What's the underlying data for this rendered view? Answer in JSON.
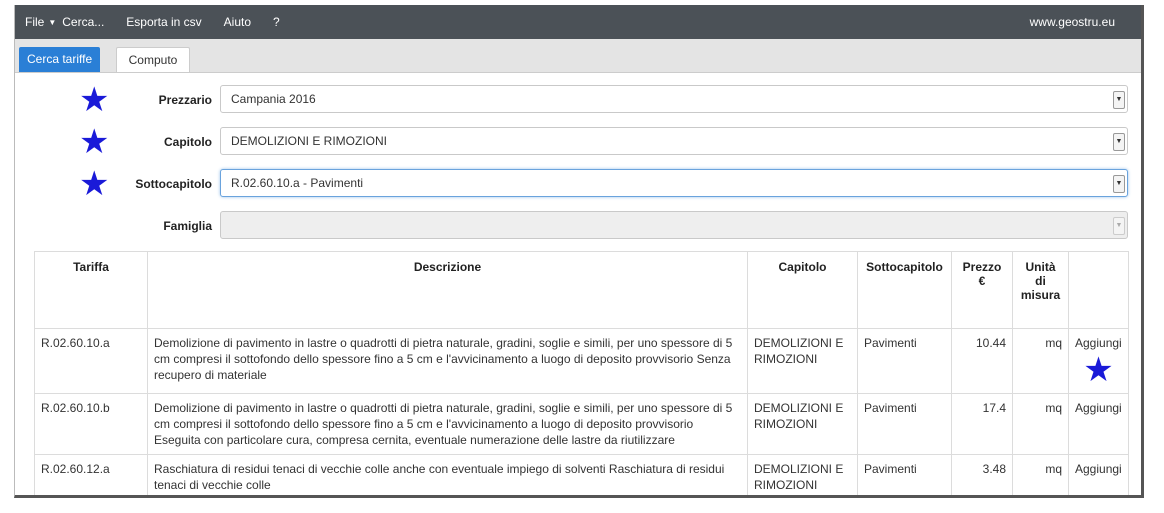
{
  "navbar": {
    "file": "File",
    "search": "Cerca...",
    "export": "Esporta in csv",
    "help": "Aiuto",
    "question": "?",
    "site": "www.geostru.eu"
  },
  "tabs": [
    {
      "label": "Cerca tariffe",
      "active": true
    },
    {
      "label": "Computo",
      "active": false
    }
  ],
  "form": {
    "prezzario": {
      "label": "Prezzario",
      "value": "Campania 2016"
    },
    "capitolo": {
      "label": "Capitolo",
      "value": "DEMOLIZIONI E RIMOZIONI"
    },
    "sottocapitolo": {
      "label": "Sottocapitolo",
      "value": "R.02.60.10.a - Pavimenti"
    },
    "famiglia": {
      "label": "Famiglia",
      "value": ""
    }
  },
  "table": {
    "headers": [
      "Tariffa",
      "Descrizione",
      "Capitolo",
      "Sottocapitolo",
      "Prezzo €",
      "Unità di misura",
      ""
    ],
    "rows": [
      {
        "tariffa": "R.02.60.10.a",
        "descrizione": "Demolizione di pavimento in lastre o quadrotti di pietra naturale, gradini, soglie e simili, per uno spessore di 5 cm compresi il sottofondo dello spessore fino a 5 cm e l'avvicinamento a luogo di deposito provvisorio Senza recupero di materiale",
        "capitolo": "DEMOLIZIONI E RIMOZIONI",
        "sottocapitolo": "Pavimenti",
        "prezzo": "10.44",
        "unita": "mq",
        "action": "Aggiungi"
      },
      {
        "tariffa": "R.02.60.10.b",
        "descrizione": "Demolizione di pavimento in lastre o quadrotti di pietra naturale, gradini, soglie e simili, per uno spessore di 5 cm compresi il sottofondo dello spessore fino a 5 cm e l'avvicinamento a luogo di deposito provvisorio Eseguita con particolare cura, compresa cernita, eventuale numerazione delle lastre da riutilizzare",
        "capitolo": "DEMOLIZIONI E RIMOZIONI",
        "sottocapitolo": "Pavimenti",
        "prezzo": "17.4",
        "unita": "mq",
        "action": "Aggiungi"
      },
      {
        "tariffa": "R.02.60.12.a",
        "descrizione": "Raschiatura di residui tenaci di vecchie colle anche con eventuale impiego di solventi Raschiatura di residui tenaci di vecchie colle",
        "capitolo": "DEMOLIZIONI E RIMOZIONI",
        "sottocapitolo": "Pavimenti",
        "prezzo": "3.48",
        "unita": "mq",
        "action": "Aggiungi"
      }
    ]
  },
  "colors": {
    "navbar": "#4b5157",
    "active_tab": "#2a7fd6",
    "star": "#1a1ad8"
  },
  "icons": {
    "star": "star-icon",
    "dropdown": "chevron-down-icon"
  }
}
